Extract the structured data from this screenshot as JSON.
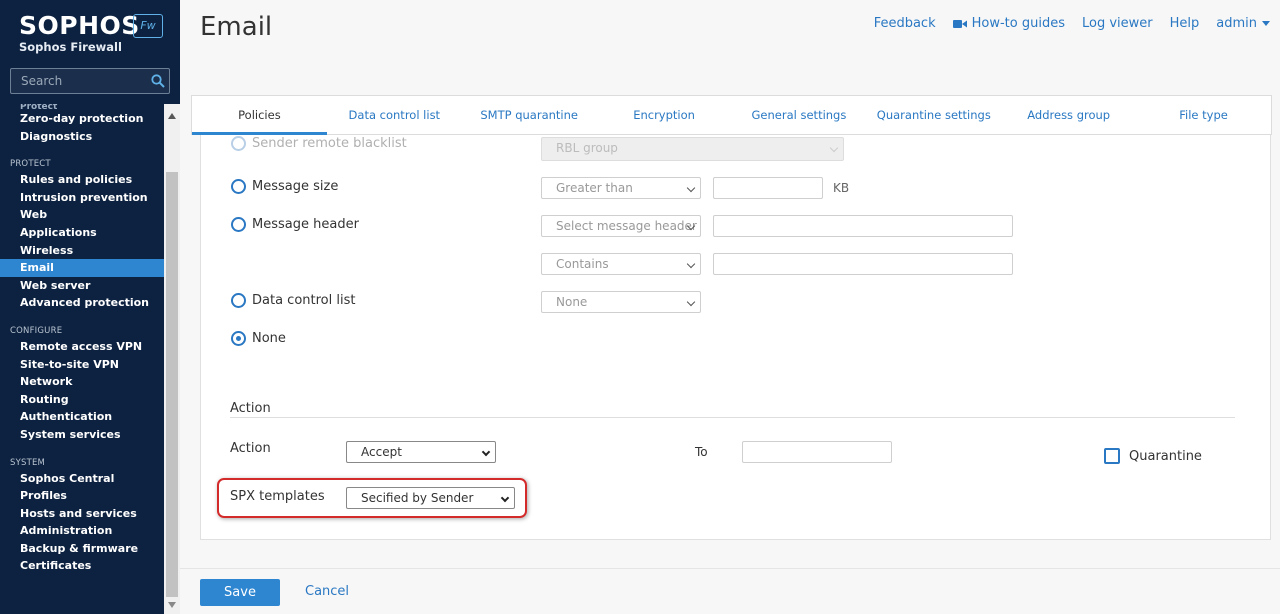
{
  "brand": {
    "name": "SOPHOS",
    "badge": "Fw",
    "subtitle": "Sophos Firewall"
  },
  "search": {
    "placeholder": "Search"
  },
  "sidebar": {
    "partial_item": "Protect",
    "monitor_items": [
      "Zero-day protection",
      "Diagnostics"
    ],
    "sections": [
      {
        "title": "PROTECT",
        "items": [
          "Rules and policies",
          "Intrusion prevention",
          "Web",
          "Applications",
          "Wireless",
          "Email",
          "Web server",
          "Advanced protection"
        ]
      },
      {
        "title": "CONFIGURE",
        "items": [
          "Remote access VPN",
          "Site-to-site VPN",
          "Network",
          "Routing",
          "Authentication",
          "System services"
        ]
      },
      {
        "title": "SYSTEM",
        "items": [
          "Sophos Central",
          "Profiles",
          "Hosts and services",
          "Administration",
          "Backup & firmware",
          "Certificates"
        ]
      }
    ],
    "active_item": "Email"
  },
  "header": {
    "title": "Email",
    "links": {
      "feedback": "Feedback",
      "howto": "How-to guides",
      "logviewer": "Log viewer",
      "help": "Help",
      "admin": "admin"
    }
  },
  "tabs": [
    "Policies",
    "Data control list",
    "SMTP quarantine",
    "Encryption",
    "General settings",
    "Quarantine settings",
    "Address group",
    "File type"
  ],
  "active_tab": "Policies",
  "criteria": {
    "sender_blacklist": {
      "label": "Sender remote blacklist",
      "select": "RBL group"
    },
    "message_size": {
      "label": "Message size",
      "operator": "Greater than",
      "unit": "KB",
      "value": ""
    },
    "message_header": {
      "label": "Message header",
      "header_select": "Select message header",
      "match_select": "Contains",
      "header_value": "",
      "match_value": ""
    },
    "data_control": {
      "label": "Data control list",
      "select": "None"
    },
    "none": {
      "label": "None",
      "checked": true
    }
  },
  "action_section": {
    "heading": "Action",
    "action_label": "Action",
    "action_value": "Accept",
    "to_label": "To",
    "to_value": "",
    "quarantine_label": "Quarantine",
    "quarantine_checked": false,
    "spx_label": "SPX templates",
    "spx_value": "Secified by Sender"
  },
  "footer": {
    "save": "Save",
    "cancel": "Cancel"
  },
  "colors": {
    "sidebar_bg": "#0d2240",
    "accent": "#2e86d1",
    "link": "#2a78c3",
    "highlight": "#d32a2a"
  }
}
